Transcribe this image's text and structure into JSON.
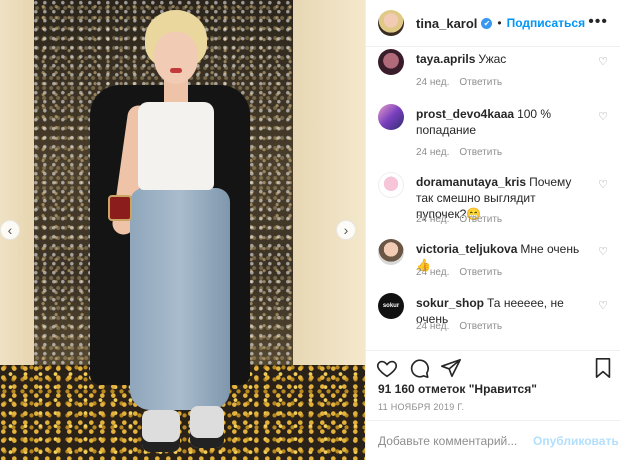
{
  "post": {
    "username": "tina_karol",
    "verified_mark": "✔",
    "dot": "•",
    "follow_label": "Подписаться",
    "more_label": "•••"
  },
  "carousel": {
    "prev_label": "‹",
    "next_label": "›"
  },
  "comments": [
    {
      "username": "taya.aprils",
      "text": "Ужас",
      "time": "24 нед.",
      "reply": "Ответить",
      "avatar_icon": "avatar-icon"
    },
    {
      "username": "prost_devo4kaaa",
      "text": "100 % попадание",
      "time": "24 нед.",
      "reply": "Ответить",
      "avatar_icon": "avatar-icon"
    },
    {
      "username": "doramanutaya_kris",
      "text": "Почему так смешно выглядит пупочек?😁",
      "time": "24 нед.",
      "reply": "Ответить",
      "avatar_icon": "avatar-icon"
    },
    {
      "username": "victoria_teljukova",
      "text": "Мне очень👍",
      "time": "24 нед.",
      "reply": "Ответить",
      "avatar_icon": "avatar-icon"
    },
    {
      "username": "sokur_shop",
      "text": "Та нееееe, не очень",
      "time": "24 нед.",
      "reply": "Ответить",
      "avatar_icon": "avatar-icon",
      "avatar_text": "sokur"
    }
  ],
  "heart_glyph": "♡",
  "likes_text": "91 160 отметок \"Нравится\"",
  "date_text": "11 НОЯБРЯ 2019 Г.",
  "comment_box": {
    "placeholder": "Добавьте комментарий...",
    "publish_label": "Опубликовать"
  },
  "colors": {
    "accent": "#0095f6",
    "publish_disabled": "#b2dffc",
    "verified": "#3897f0",
    "muted": "#8e8e8e"
  }
}
